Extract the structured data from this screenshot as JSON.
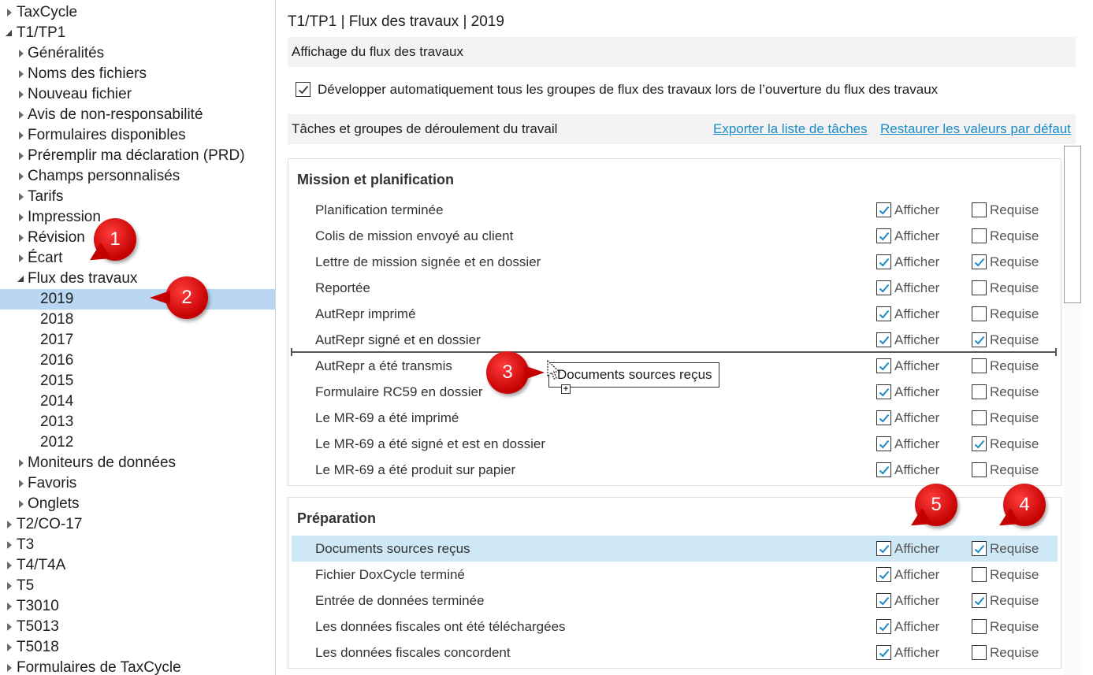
{
  "tree": {
    "items": [
      {
        "label": "TaxCycle",
        "level": 0,
        "state": "collapsed"
      },
      {
        "label": "T1/TP1",
        "level": 0,
        "state": "expanded"
      },
      {
        "label": "Généralités",
        "level": 1,
        "state": "collapsed"
      },
      {
        "label": "Noms des fichiers",
        "level": 1,
        "state": "collapsed"
      },
      {
        "label": "Nouveau fichier",
        "level": 1,
        "state": "collapsed"
      },
      {
        "label": "Avis de non-responsabilité",
        "level": 1,
        "state": "collapsed"
      },
      {
        "label": "Formulaires disponibles",
        "level": 1,
        "state": "collapsed"
      },
      {
        "label": "Préremplir ma déclaration (PRD)",
        "level": 1,
        "state": "collapsed"
      },
      {
        "label": "Champs personnalisés",
        "level": 1,
        "state": "collapsed"
      },
      {
        "label": "Tarifs",
        "level": 1,
        "state": "collapsed"
      },
      {
        "label": "Impression",
        "level": 1,
        "state": "collapsed"
      },
      {
        "label": "Révision",
        "level": 1,
        "state": "collapsed"
      },
      {
        "label": "Écart",
        "level": 1,
        "state": "collapsed"
      },
      {
        "label": "Flux des travaux",
        "level": 1,
        "state": "expanded"
      },
      {
        "label": "2019",
        "level": 2,
        "state": "leaf",
        "selected": true
      },
      {
        "label": "2018",
        "level": 2,
        "state": "leaf"
      },
      {
        "label": "2017",
        "level": 2,
        "state": "leaf"
      },
      {
        "label": "2016",
        "level": 2,
        "state": "leaf"
      },
      {
        "label": "2015",
        "level": 2,
        "state": "leaf"
      },
      {
        "label": "2014",
        "level": 2,
        "state": "leaf"
      },
      {
        "label": "2013",
        "level": 2,
        "state": "leaf"
      },
      {
        "label": "2012",
        "level": 2,
        "state": "leaf"
      },
      {
        "label": "Moniteurs de données",
        "level": 1,
        "state": "collapsed"
      },
      {
        "label": "Favoris",
        "level": 1,
        "state": "collapsed"
      },
      {
        "label": "Onglets",
        "level": 1,
        "state": "collapsed"
      },
      {
        "label": "T2/CO-17",
        "level": 0,
        "state": "collapsed"
      },
      {
        "label": "T3",
        "level": 0,
        "state": "collapsed"
      },
      {
        "label": "T4/T4A",
        "level": 0,
        "state": "collapsed"
      },
      {
        "label": "T5",
        "level": 0,
        "state": "collapsed"
      },
      {
        "label": "T3010",
        "level": 0,
        "state": "collapsed"
      },
      {
        "label": "T5013",
        "level": 0,
        "state": "collapsed"
      },
      {
        "label": "T5018",
        "level": 0,
        "state": "collapsed"
      },
      {
        "label": "Formulaires de TaxCycle",
        "level": 0,
        "state": "collapsed"
      }
    ]
  },
  "panel": {
    "title": "T1/TP1 | Flux des travaux | 2019",
    "display_section": "Affichage du flux des travaux",
    "auto_expand": {
      "label": "Développer automatiquement tous les groupes de flux des travaux lors de l’ouverture du flux des travaux",
      "checked": true
    },
    "tasks_section": "Tâches et groupes de déroulement du travail",
    "export_link": "Exporter la liste de tâches",
    "restore_link": "Restaurer les valeurs par défaut",
    "show_label": "Afficher",
    "required_label": "Requise",
    "groups": [
      {
        "title": "Mission et planification",
        "tasks": [
          {
            "name": "Planification terminée",
            "show": true,
            "required": false
          },
          {
            "name": "Colis de mission envoyé au client",
            "show": true,
            "required": false
          },
          {
            "name": "Lettre de mission signée et en dossier",
            "show": true,
            "required": true
          },
          {
            "name": "Reportée",
            "show": true,
            "required": false
          },
          {
            "name": "AutRepr imprimé",
            "show": true,
            "required": false
          },
          {
            "name": "AutRepr signé et en dossier",
            "show": true,
            "required": true
          },
          {
            "name": "AutRepr a été transmis",
            "show": true,
            "required": false
          },
          {
            "name": "Formulaire RC59 en dossier",
            "show": true,
            "required": false
          },
          {
            "name": "Le MR-69 a été imprimé",
            "show": true,
            "required": false
          },
          {
            "name": "Le MR-69 a été signé et est en dossier",
            "show": true,
            "required": true
          },
          {
            "name": "Le MR-69 a été produit sur papier",
            "show": true,
            "required": false
          }
        ]
      },
      {
        "title": "Préparation",
        "tasks": [
          {
            "name": "Documents sources reçus",
            "show": true,
            "required": true,
            "highlighted": true
          },
          {
            "name": "Fichier DoxCycle terminé",
            "show": true,
            "required": false
          },
          {
            "name": "Entrée de données terminée",
            "show": true,
            "required": true
          },
          {
            "name": "Les données fiscales ont été téléchargées",
            "show": true,
            "required": false
          },
          {
            "name": "Les données fiscales concordent",
            "show": true,
            "required": false
          }
        ]
      }
    ],
    "drag_ghost": "Documents sources reçus"
  },
  "callouts": [
    "1",
    "2",
    "3",
    "4",
    "5"
  ],
  "colors": {
    "accent": "#1a8bc7",
    "selection": "#b9d7f2",
    "highlight": "#cfe8f5",
    "check": "#1a8bc7",
    "callout": "#d40000"
  }
}
